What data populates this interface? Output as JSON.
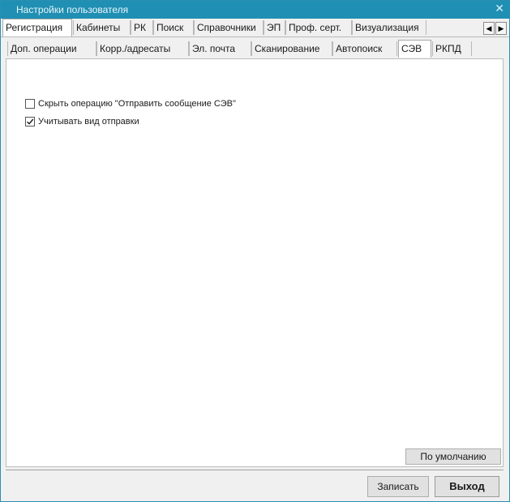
{
  "window": {
    "title": "Настройки пользователя",
    "close_glyph": "✕"
  },
  "tabs_top": [
    {
      "label": "Регистрация",
      "active": true
    },
    {
      "label": "Кабинеты"
    },
    {
      "label": "РК"
    },
    {
      "label": "Поиск"
    },
    {
      "label": "Справочники"
    },
    {
      "label": "ЭП"
    },
    {
      "label": "Проф. серт."
    },
    {
      "label": "Визуализация"
    }
  ],
  "tab_scroll": {
    "left_icon": "chevron-left-icon",
    "right_icon": "chevron-right-icon",
    "left_glyph": "◀",
    "right_glyph": "▶"
  },
  "tabs_sub": [
    {
      "label": "Доп. операции"
    },
    {
      "label": "Корр./адресаты"
    },
    {
      "label": "Эл. почта"
    },
    {
      "label": "Сканирование"
    },
    {
      "label": "Автопоиск"
    },
    {
      "label": "СЭВ",
      "active": true
    },
    {
      "label": "РКПД"
    }
  ],
  "options": [
    {
      "label": "Скрыть операцию \"Отправить сообщение СЭВ\"",
      "checked": false
    },
    {
      "label": "Учитывать вид отправки",
      "checked": true
    }
  ],
  "buttons": {
    "default": "По умолчанию",
    "save": "Записать",
    "exit": "Выход"
  },
  "colors": {
    "titlebar": "#1f8fb3",
    "panel": "#ffffff",
    "window": "#f0f0f0"
  }
}
